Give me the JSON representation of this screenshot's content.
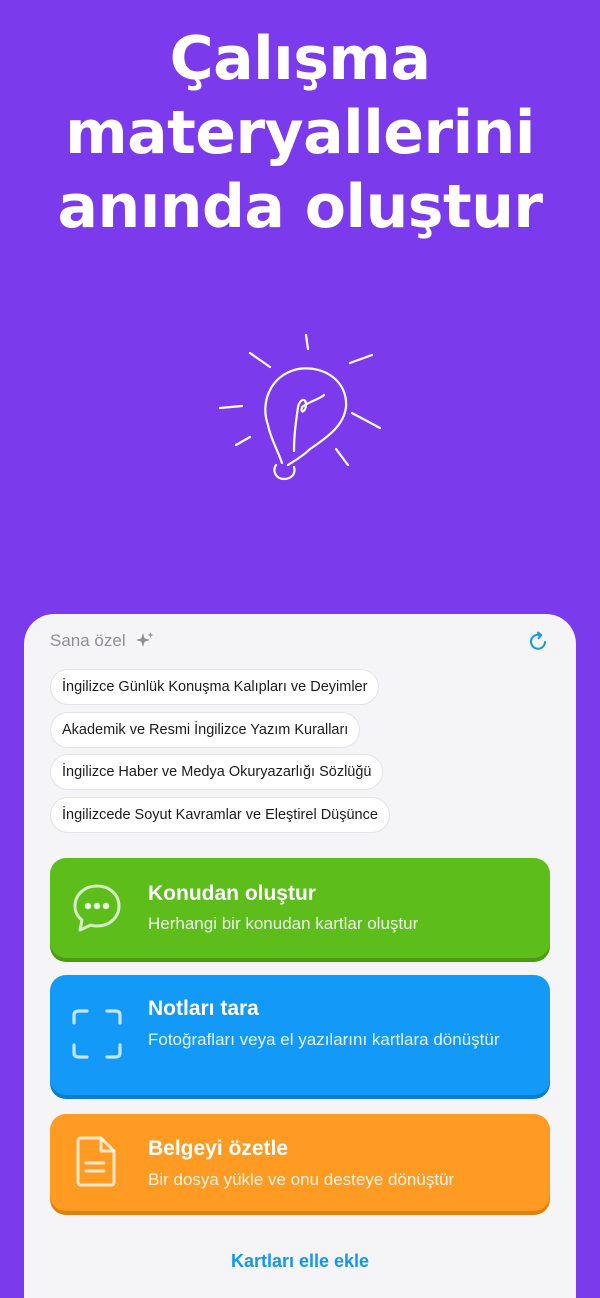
{
  "headline": {
    "line1": "Çalışma",
    "line2": "materyallerini",
    "line3": "anında oluştur"
  },
  "illustration": {
    "icon": "lightbulb-icon"
  },
  "card": {
    "header_label": "Sana özel",
    "sparkle_icon": "sparkle-icon",
    "refresh_icon": "refresh-icon",
    "suggestions": [
      "İngilizce Günlük Konuşma Kalıpları ve Deyimler",
      "Akademik ve Resmi İngilizce Yazım Kuralları",
      "İngilizce Haber ve Medya Okuryazarlığı Sözlüğü",
      "İngilizcede Soyut Kavramlar ve Eleştirel Düşünce"
    ],
    "actions": [
      {
        "title": "Konudan oluştur",
        "subtitle": "Herhangi bir konudan kartlar oluştur",
        "icon": "chat-bubble-icon",
        "color": "#5CBD1B"
      },
      {
        "title": "Notları tara",
        "subtitle": "Fotoğrafları veya el yazılarını kartlara dönüştür",
        "icon": "scan-icon",
        "color": "#1399F8"
      },
      {
        "title": "Belgeyi özetle",
        "subtitle": "Bir dosya yükle ve onu desteye dönüştür",
        "icon": "document-icon",
        "color": "#FF9A22"
      }
    ],
    "manual_link": "Kartları elle ekle"
  },
  "colors": {
    "background": "#7B3AEC",
    "accent_link": "#1497E8"
  }
}
